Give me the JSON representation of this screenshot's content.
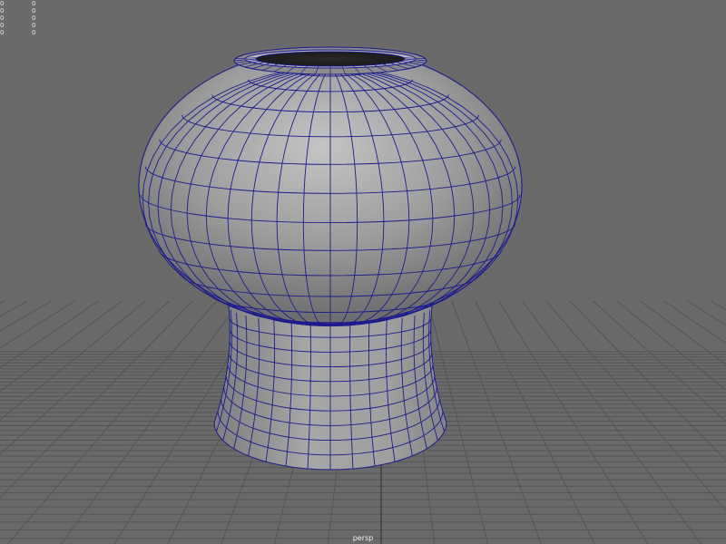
{
  "viewport": {
    "camera": "persp",
    "background_color": "#6a6a6a",
    "grid_color": "#555555",
    "grid_axis_color": "#3e3e3e",
    "wire_color": "#1e1c8c",
    "mesh_color": "#9c9c9c"
  },
  "hud": {
    "rows": [
      {
        "label": "0",
        "value": "0"
      },
      {
        "label": "0",
        "value": "0"
      },
      {
        "label": "0",
        "value": "0"
      },
      {
        "label": "0",
        "value": "0"
      },
      {
        "label": "0",
        "value": "0"
      }
    ]
  }
}
